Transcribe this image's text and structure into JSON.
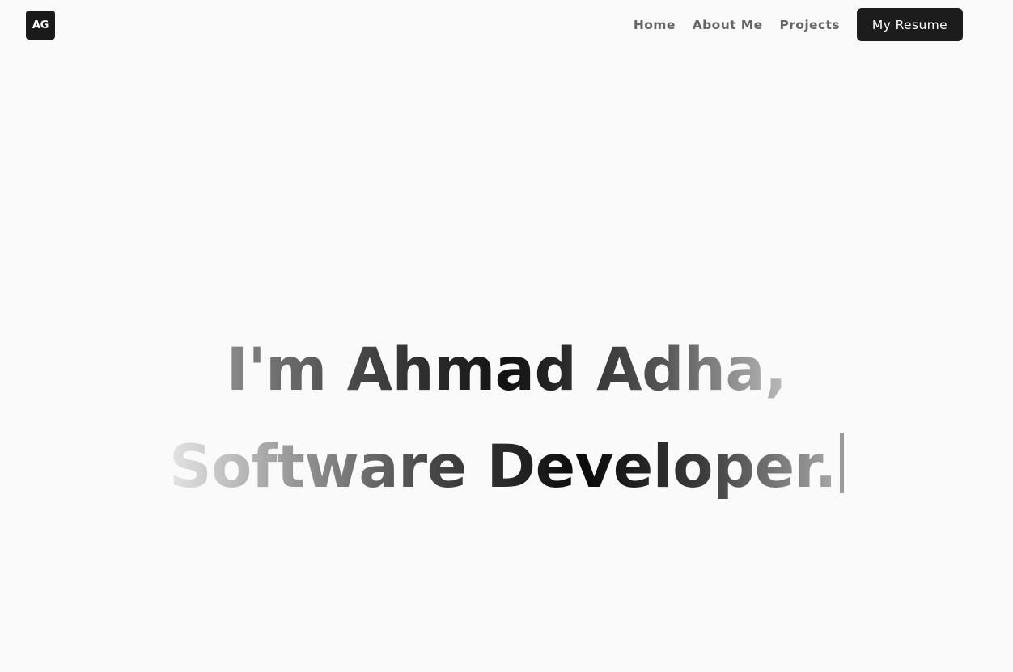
{
  "logo": {
    "text": "AG"
  },
  "nav": {
    "links": [
      {
        "label": "Home"
      },
      {
        "label": "About Me"
      },
      {
        "label": "Projects"
      }
    ],
    "resume_label": "My Resume"
  },
  "hero": {
    "line1": "I'm Ahmad Adha,",
    "line2": "Software Developer.",
    "cursor": "|"
  },
  "colors": {
    "background": "#fafafa",
    "button_bg": "#1c1c1c",
    "nav_text": "#666666"
  }
}
